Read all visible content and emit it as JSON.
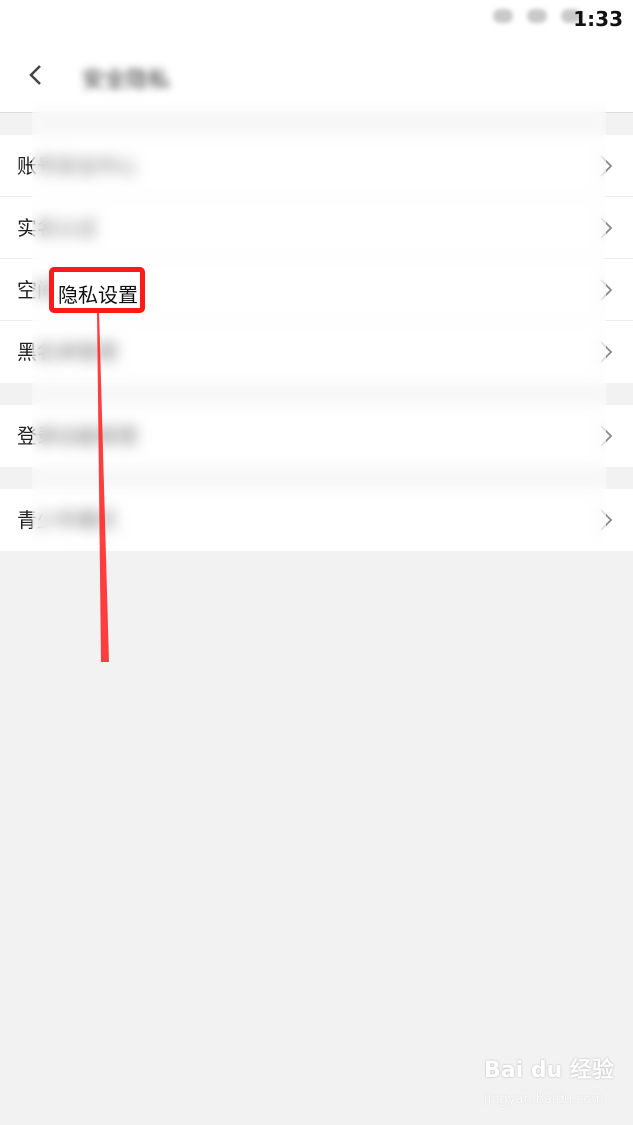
{
  "status_bar": {
    "time": "1:33"
  },
  "header": {
    "title": "安全隐私"
  },
  "groups": [
    {
      "items": [
        {
          "label": "账号安全中心"
        },
        {
          "label": "实名认证"
        },
        {
          "label": "空间隐私设置"
        },
        {
          "label": "黑名单管理"
        }
      ]
    },
    {
      "items": [
        {
          "label": "登录设备管理"
        }
      ]
    },
    {
      "items": [
        {
          "label": "青少年模式"
        }
      ]
    }
  ],
  "annotation": {
    "highlight_text": "隐私设置",
    "color": "#ff1a1a"
  },
  "watermark": {
    "text": "Bai du 经验",
    "subtext": "jingyan.baidu.com"
  }
}
